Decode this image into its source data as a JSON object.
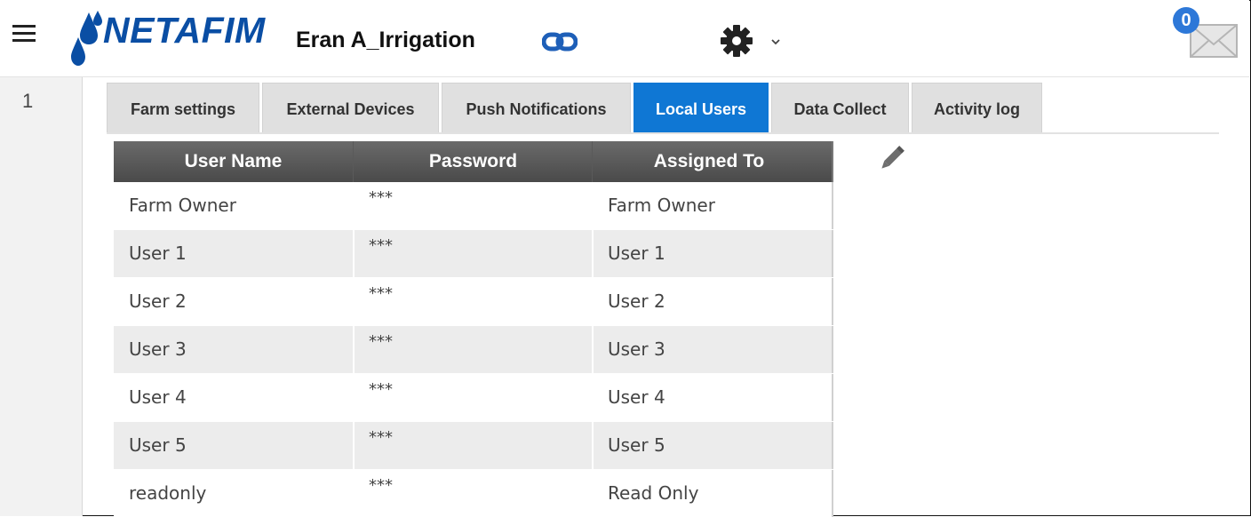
{
  "header": {
    "brand": "NETAFIM",
    "farm_name": "Eran A_Irrigation",
    "notification_count": "0",
    "icons": [
      "menu-icon",
      "netafim-drop-logo",
      "link-icon",
      "gear-icon",
      "chevron-down-icon",
      "mail-icon"
    ]
  },
  "gutter": {
    "number": "1"
  },
  "tabs": [
    {
      "label": "Farm settings",
      "active": false
    },
    {
      "label": "External Devices",
      "active": false
    },
    {
      "label": "Push Notifications",
      "active": false
    },
    {
      "label": "Local Users",
      "active": true
    },
    {
      "label": "Data Collect",
      "active": false
    },
    {
      "label": "Activity log",
      "active": false
    }
  ],
  "table": {
    "columns": [
      "User Name",
      "Password",
      "Assigned To"
    ],
    "rows": [
      [
        "Farm Owner",
        "***",
        "Farm Owner"
      ],
      [
        "User 1",
        "***",
        "User 1"
      ],
      [
        "User 2",
        "***",
        "User 2"
      ],
      [
        "User 3",
        "***",
        "User 3"
      ],
      [
        "User 4",
        "***",
        "User 4"
      ],
      [
        "User 5",
        "***",
        "User 5"
      ],
      [
        "readonly",
        "***",
        "Read Only"
      ]
    ]
  },
  "colors": {
    "brand_blue": "#0a4ea4",
    "active_tab": "#0f77d4",
    "badge": "#2d78d8",
    "table_header": "#555555"
  }
}
